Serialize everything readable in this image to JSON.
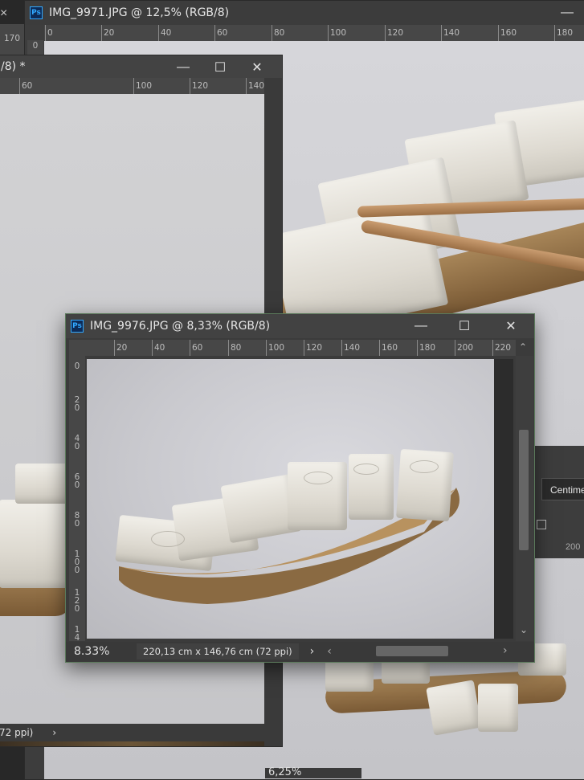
{
  "windows": {
    "back": {
      "title": "IMG_9971.JPG @ 12,5% (RGB/8)",
      "ruler_h": [
        "0",
        "20",
        "40",
        "60",
        "80",
        "100",
        "120",
        "140",
        "160",
        "180"
      ],
      "ruler_v": [
        "0"
      ],
      "zoom": "6,25%",
      "corner_values": [
        "170",
        "0"
      ],
      "close_glyph": "×"
    },
    "middle": {
      "title_fragment": "/8) *",
      "ruler_h": [
        "60",
        "100",
        "120",
        "140"
      ],
      "status_fragment": "72 ppi)"
    },
    "front": {
      "title": "IMG_9976.JPG @ 8,33% (RGB/8)",
      "ruler_h": [
        "20",
        "40",
        "60",
        "80",
        "100",
        "120",
        "140",
        "160",
        "180",
        "200",
        "220"
      ],
      "ruler_v": [
        "0",
        "20",
        "40",
        "60",
        "80",
        "100",
        "120",
        "14"
      ],
      "zoom": "8.33%",
      "doc_info": "220,13 cm x 146,76 cm (72 ppi)"
    },
    "right_panel": {
      "unit_select": "Centime",
      "value": "200"
    }
  },
  "icons": {
    "minimize": "—",
    "maximize": "☐",
    "close": "✕",
    "chevron_right": "›",
    "chevron_left": "‹",
    "chevron_up": "⌃",
    "chevron_down": "⌄"
  },
  "colors": {
    "ps_blue": "#31a8ff",
    "panel": "#3d3d3d",
    "canvas_gray": "#c8c8cc"
  }
}
